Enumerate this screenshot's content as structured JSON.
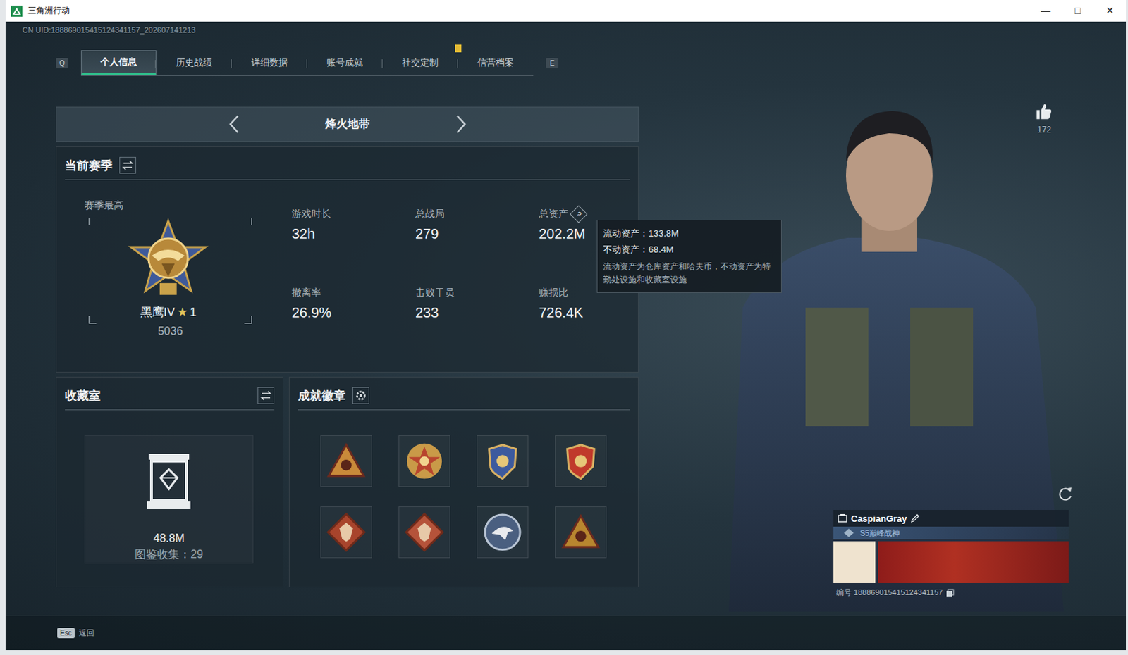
{
  "window": {
    "title": "三角洲行动",
    "controls": [
      "—",
      "□",
      "✕"
    ]
  },
  "uid": "CN UID:188869015415124341157_202607141213",
  "tabs": {
    "prev_key": "Q",
    "next_key": "E",
    "items": [
      {
        "label": "个人信息",
        "selected": true,
        "notice": false
      },
      {
        "label": "历史战绩",
        "selected": false,
        "notice": false
      },
      {
        "label": "详细数据",
        "selected": false,
        "notice": false
      },
      {
        "label": "账号成就",
        "selected": false,
        "notice": false
      },
      {
        "label": "社交定制",
        "selected": false,
        "notice": true
      },
      {
        "label": "信营档案",
        "selected": false,
        "notice": false
      }
    ]
  },
  "mode": {
    "title": "烽火地带"
  },
  "season": {
    "title": "当前赛季",
    "best_label": "赛季最高",
    "rank": "黑鹰IV",
    "star": "★",
    "star_count": "1",
    "score": "5036",
    "help_glyph": "?",
    "stats": [
      {
        "label": "游戏时长",
        "value": "32h",
        "help": false
      },
      {
        "label": "总战局",
        "value": "279",
        "help": false
      },
      {
        "label": "总资产",
        "value": "202.2M",
        "help": true
      },
      {
        "label": "撤离率",
        "value": "26.9%",
        "help": false
      },
      {
        "label": "击败干员",
        "value": "233",
        "help": false
      },
      {
        "label": "赚损比",
        "value": "726.4K",
        "help": false
      }
    ]
  },
  "tooltip": {
    "lines": [
      "流动资产：133.8M",
      "不动资产：68.4M"
    ],
    "note": "流动资产为仓库资产和哈夫币，不动资产为特勤处设施和收藏室设施"
  },
  "collection": {
    "title": "收藏室",
    "value": "48.8M",
    "catalog": "图鉴收集：29"
  },
  "badges": {
    "title": "成就徽章",
    "items": [
      {
        "kind": "triangle",
        "color": "#c98a3a"
      },
      {
        "kind": "star",
        "color": "#b8452e"
      },
      {
        "kind": "shield",
        "color": "#3d5a9e"
      },
      {
        "kind": "shield",
        "color": "#c0392b"
      },
      {
        "kind": "diamond",
        "color": "#a8442c"
      },
      {
        "kind": "diamond",
        "color": "#b5533a"
      },
      {
        "kind": "circle",
        "color": "#4a5f80"
      },
      {
        "kind": "triangle",
        "color": "#b8862f"
      }
    ]
  },
  "profile": {
    "likes": "172",
    "name": "CaspianGray",
    "title": "S5巅峰战神",
    "id": "编号 188869015415124341157"
  },
  "footer": {
    "key": "Esc",
    "label": "返回"
  }
}
